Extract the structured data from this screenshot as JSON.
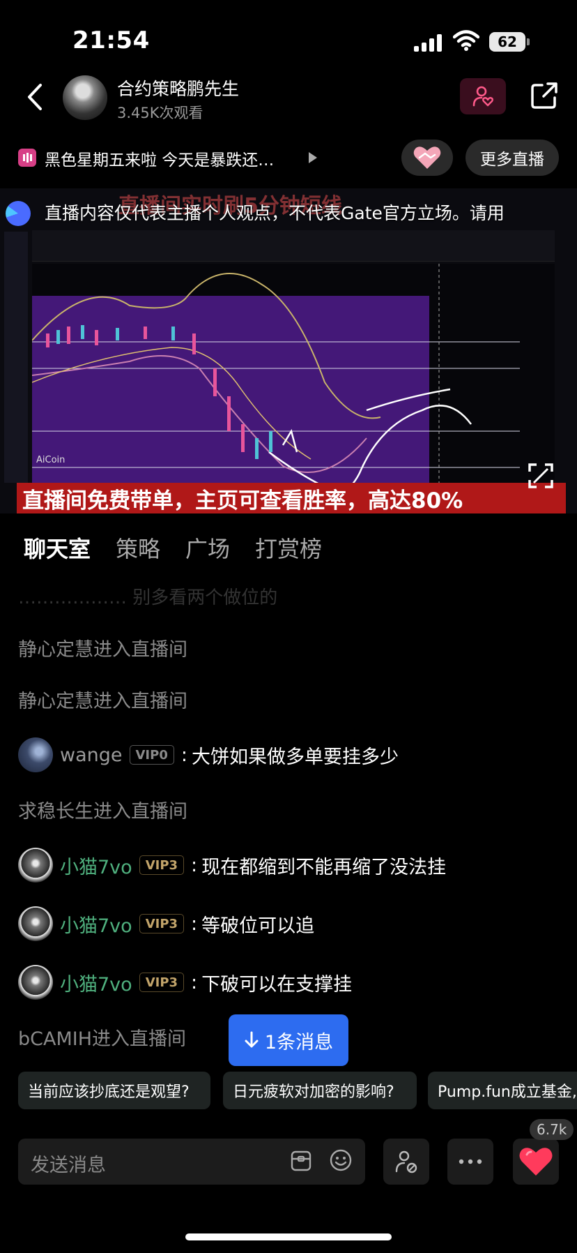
{
  "status_bar": {
    "time": "21:54",
    "battery": "62"
  },
  "host": {
    "name": "合约策略鹏先生",
    "viewers": "3.45K次观看"
  },
  "topic": {
    "text": "黑色星期五来啦 今天是暴跌还…"
  },
  "header": {
    "more_live_label": "更多直播"
  },
  "video": {
    "disclaimer": "直播内容仅代表主播个人观点，不代表Gate官方立场。请用",
    "top_banner": "直播间实时刷5分钟短线",
    "bottom_banner": "直播间免费带单，主页可查看胜率，高达80%",
    "watermark": "AiCoin"
  },
  "tabs": [
    "聊天室",
    "策略",
    "广场",
    "打赏榜"
  ],
  "chat": {
    "faded": "……………… 别多看两个做位的",
    "messages": [
      {
        "type": "system",
        "text": "静心定慧进入直播间"
      },
      {
        "type": "system",
        "text": "静心定慧进入直播间"
      },
      {
        "type": "user",
        "user": "wange",
        "vip": "VIP0",
        "text": "大饼如果做多单要挂多少"
      },
      {
        "type": "system",
        "text": "求稳长生进入直播间"
      },
      {
        "type": "user",
        "user": "小猫7vo",
        "vip": "VIP3",
        "text": "现在都缩到不能再缩了没法挂"
      },
      {
        "type": "user",
        "user": "小猫7vo",
        "vip": "VIP3",
        "text": "等破位可以追"
      },
      {
        "type": "user",
        "user": "小猫7vo",
        "vip": "VIP3",
        "text": "下破可以在支撑挂"
      },
      {
        "type": "system",
        "text": "bCAMIH进入直播间"
      }
    ],
    "new_message_label": "1条消息"
  },
  "suggestions": [
    "当前应该抄底还是观望?",
    "日元疲软对加密的影响?",
    "Pump.fun成立基金,"
  ],
  "input": {
    "placeholder": "发送消息",
    "like_count": "6.7k"
  },
  "colors": {
    "accent_blue": "#2d6cf0",
    "vip_name_green": "#4fb07e",
    "like_red": "#ff3b5c",
    "banner_red": "#b01818"
  },
  "icons": [
    "back-icon",
    "follow-icon",
    "share-icon",
    "heart-handshake-icon",
    "fullscreen-icon",
    "gift-box-icon",
    "emoji-icon",
    "user-settings-icon",
    "more-icon",
    "heart-like-icon",
    "arrow-down-icon"
  ]
}
